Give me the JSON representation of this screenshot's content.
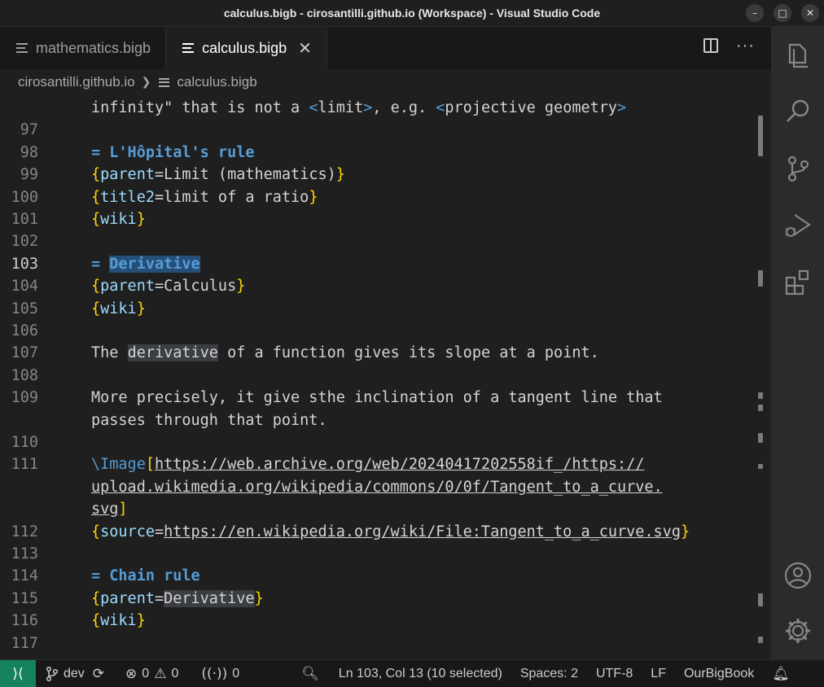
{
  "window": {
    "title": "calculus.bigb - cirosantilli.github.io (Workspace) - Visual Studio Code"
  },
  "tabs": [
    {
      "label": "mathematics.bigb",
      "active": false
    },
    {
      "label": "calculus.bigb",
      "active": true,
      "close": "✕"
    }
  ],
  "breadcrumb": {
    "folder": "cirosantilli.github.io",
    "file": "calculus.bigb"
  },
  "editor": {
    "lines": [
      {
        "n": "",
        "text": "infinity\" that is not a <limit>, e.g. <projective geometry>"
      },
      {
        "n": "97",
        "text": ""
      },
      {
        "n": "98",
        "text": "= L'Hôpital's rule"
      },
      {
        "n": "99",
        "text": "{parent=Limit (mathematics)}"
      },
      {
        "n": "100",
        "text": "{title2=limit of a ratio}"
      },
      {
        "n": "101",
        "text": "{wiki}"
      },
      {
        "n": "102",
        "text": ""
      },
      {
        "n": "103",
        "text": "= Derivative"
      },
      {
        "n": "104",
        "text": "{parent=Calculus}"
      },
      {
        "n": "105",
        "text": "{wiki}"
      },
      {
        "n": "106",
        "text": ""
      },
      {
        "n": "107",
        "text": "The derivative of a function gives its slope at a point."
      },
      {
        "n": "108",
        "text": ""
      },
      {
        "n": "109",
        "text": "More precisely, it give sthe inclination of a tangent line that"
      },
      {
        "n": "",
        "text": "passes through that point."
      },
      {
        "n": "110",
        "text": ""
      },
      {
        "n": "111",
        "text": "\\Image[https://web.archive.org/web/20240417202558if_/https://"
      },
      {
        "n": "",
        "text": "upload.wikimedia.org/wikipedia/commons/0/0f/Tangent_to_a_curve."
      },
      {
        "n": "",
        "text": "svg]"
      },
      {
        "n": "112",
        "text": "{source=https://en.wikipedia.org/wiki/File:Tangent_to_a_curve.svg}"
      },
      {
        "n": "113",
        "text": ""
      },
      {
        "n": "114",
        "text": "= Chain rule"
      },
      {
        "n": "115",
        "text": "{parent=Derivative}"
      },
      {
        "n": "116",
        "text": "{wiki}"
      },
      {
        "n": "117",
        "text": ""
      }
    ]
  },
  "status": {
    "branch": "dev",
    "errors": "0",
    "warnings": "0",
    "ports": "0",
    "cursor": "Ln 103, Col 13 (10 selected)",
    "spaces": "Spaces: 2",
    "encoding": "UTF-8",
    "eol": "LF",
    "language": "OurBigBook"
  },
  "activity_icons": [
    "explorer-icon",
    "search-icon",
    "source-control-icon",
    "run-debug-icon",
    "extensions-icon",
    "account-icon",
    "settings-gear-icon"
  ],
  "colors": {
    "heading": "#569cd6",
    "bracket": "#ffd700",
    "attribute": "#9cdcfe",
    "selection": "#264f78",
    "remote": "#16825d"
  }
}
